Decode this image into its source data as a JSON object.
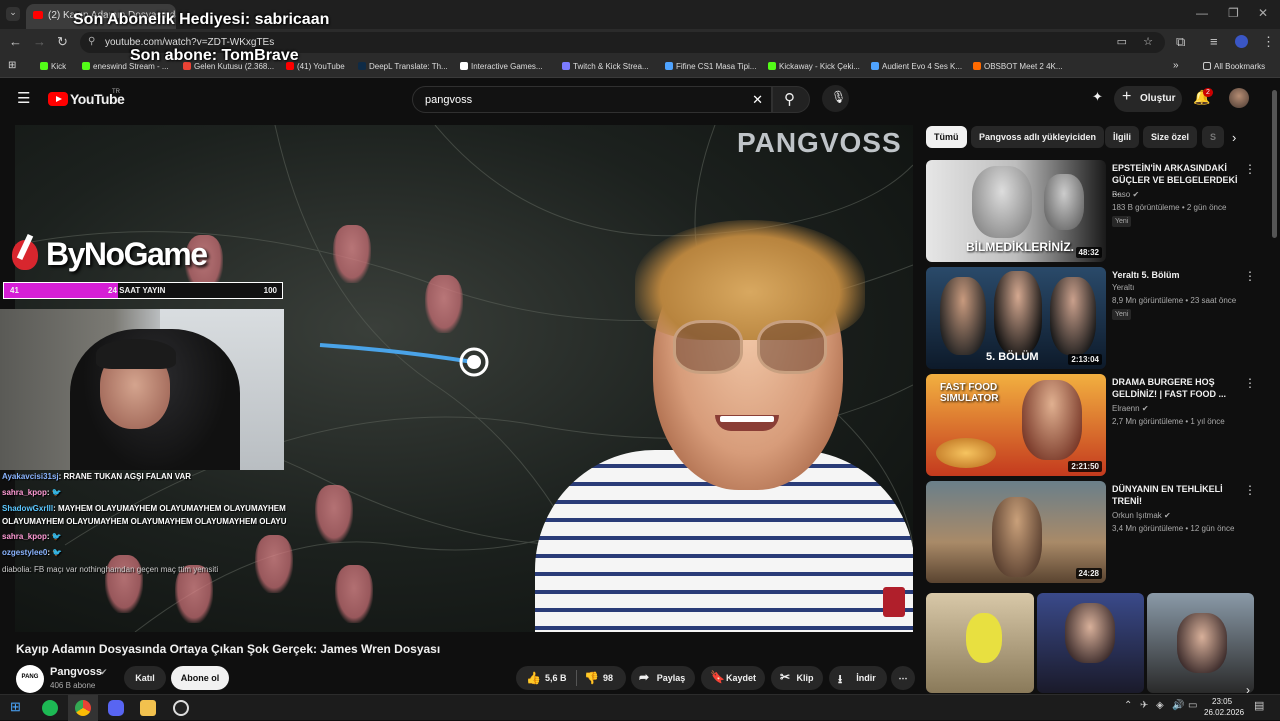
{
  "browser": {
    "tab_title": "(2) Kayıp Adamın Dosyasında",
    "url": "youtube.com/watch?v=ZDT-WKxgTEs",
    "bookmarks": [
      {
        "label": "Kick",
        "color": "#53fc18"
      },
      {
        "label": "eneswind Stream - ...",
        "color": "#53fc18"
      },
      {
        "label": "Gelen Kutusu (2.368...",
        "color": "#ea4335"
      },
      {
        "label": "(41) YouTube",
        "color": "#ff0000"
      },
      {
        "label": "DeepL Translate: Th...",
        "color": "#0f2b46"
      },
      {
        "label": "Interactive Games...",
        "color": "#ffffff"
      },
      {
        "label": "Twitch & Kick Strea...",
        "color": "#7b7bff"
      },
      {
        "label": "Fifine CS1 Masa Tipi...",
        "color": "#4fa3ff"
      },
      {
        "label": "Kickaway - Kick Çeki...",
        "color": "#53fc18"
      },
      {
        "label": "Audient Evo 4 Ses K...",
        "color": "#4fa3ff"
      },
      {
        "label": "OBSBOT Meet 2 4K...",
        "color": "#ff6a00"
      }
    ],
    "all_bookmarks": "All Bookmarks"
  },
  "stream_overlay": {
    "last_gift": "Son Abonelik Hediyesi: sabricaan",
    "last_sub": "Son abone: TomBrave",
    "brand": "ByNoGame",
    "bar_left": "41",
    "bar_label": "24 SAAT YAYIN",
    "bar_right": "100",
    "bar_fill_fraction": 0.41,
    "chat": [
      {
        "user": "Ayakavcisi31sj",
        "user_color": "#8ab4ff",
        "text": ": RRANE TUKAN AGŞI FALAN VAR"
      },
      {
        "user": "sahra_kpop",
        "user_color": "#ff9ad5",
        "text": ": 🐦"
      },
      {
        "user": "ShadowGxrlll",
        "user_color": "#5cc8ff",
        "text": ": MAYHEM OLAYUMAYHEM OLAYUMAYHEM OLAYUMAYHEM"
      },
      {
        "user": "",
        "user_color": "#ffffff",
        "text": "OLAYUMAYHEM OLAYUMAYHEM OLAYUMAYHEM OLAYUMAYHEM OLAYU"
      },
      {
        "user": "sahra_kpop",
        "user_color": "#ff9ad5",
        "text": ": 🐦"
      },
      {
        "user": "ozgestylee0",
        "user_color": "#8ab4ff",
        "text": ": 🐦"
      },
      {
        "user": "diabolia",
        "user_color": "#cccccc",
        "text": ": FB maçı var nothinghamdan geçen maç ttim yemsiti"
      }
    ]
  },
  "youtube": {
    "logo": "YouTube",
    "logo_sup": "TR",
    "search_value": "pangvoss",
    "create_label": "Oluştur",
    "notif_count": "2",
    "video_watermark": "PANGVOSS",
    "video_title": "Kayıp Adamın Dosyasında Ortaya Çıkan Şok Gerçek: James Wren Dosyası",
    "channel_name": "Pangvoss",
    "channel_subs": "406 B abone",
    "join_label": "Katıl",
    "subscribe_label": "Abone ol",
    "likes": "5,6 B",
    "dislikes": "98",
    "share_label": "Paylaş",
    "save_label": "Kaydet",
    "clip_label": "Klip",
    "download_label": "İndir",
    "chips": [
      "Tümü",
      "Pangvoss adlı yükleyiciden",
      "İlgili",
      "Size özel",
      "S"
    ],
    "recommendations": [
      {
        "title": "EPSTEİN'İN ARKASINDAKİ GÜÇLER VE BELGELERDEKİ ...",
        "channel": "Baso",
        "verified": true,
        "meta": "183 B görüntüleme • 2 gün önce",
        "badge": "Yeni",
        "duration": "48:32",
        "thumb_text": "BİLMEDİKLERİNİZ."
      },
      {
        "title": "Yeraltı 5. Bölüm",
        "channel": "Yeraltı",
        "verified": false,
        "meta": "8,9 Mn görüntüleme • 23 saat önce",
        "badge": "Yeni",
        "duration": "2:13:04",
        "thumb_text": "5. BÖLÜM"
      },
      {
        "title": "DRAMA BURGERE HOŞ GELDİNİZ! | FAST FOOD ...",
        "channel": "Elraenn",
        "verified": true,
        "meta": "2,7 Mn görüntüleme • 1 yıl önce",
        "badge": "",
        "duration": "2:21:50",
        "thumb_text": "FAST FOOD SIMULATOR"
      },
      {
        "title": "DÜNYANIN EN TEHLİKELİ TRENİ!",
        "channel": "Orkun Işıtmak",
        "verified": true,
        "meta": "3,4 Mn görüntüleme • 12 gün önce",
        "badge": "",
        "duration": "24:28",
        "thumb_text": ""
      }
    ]
  },
  "taskbar": {
    "time": "23:05",
    "date": "26.02.2026"
  }
}
